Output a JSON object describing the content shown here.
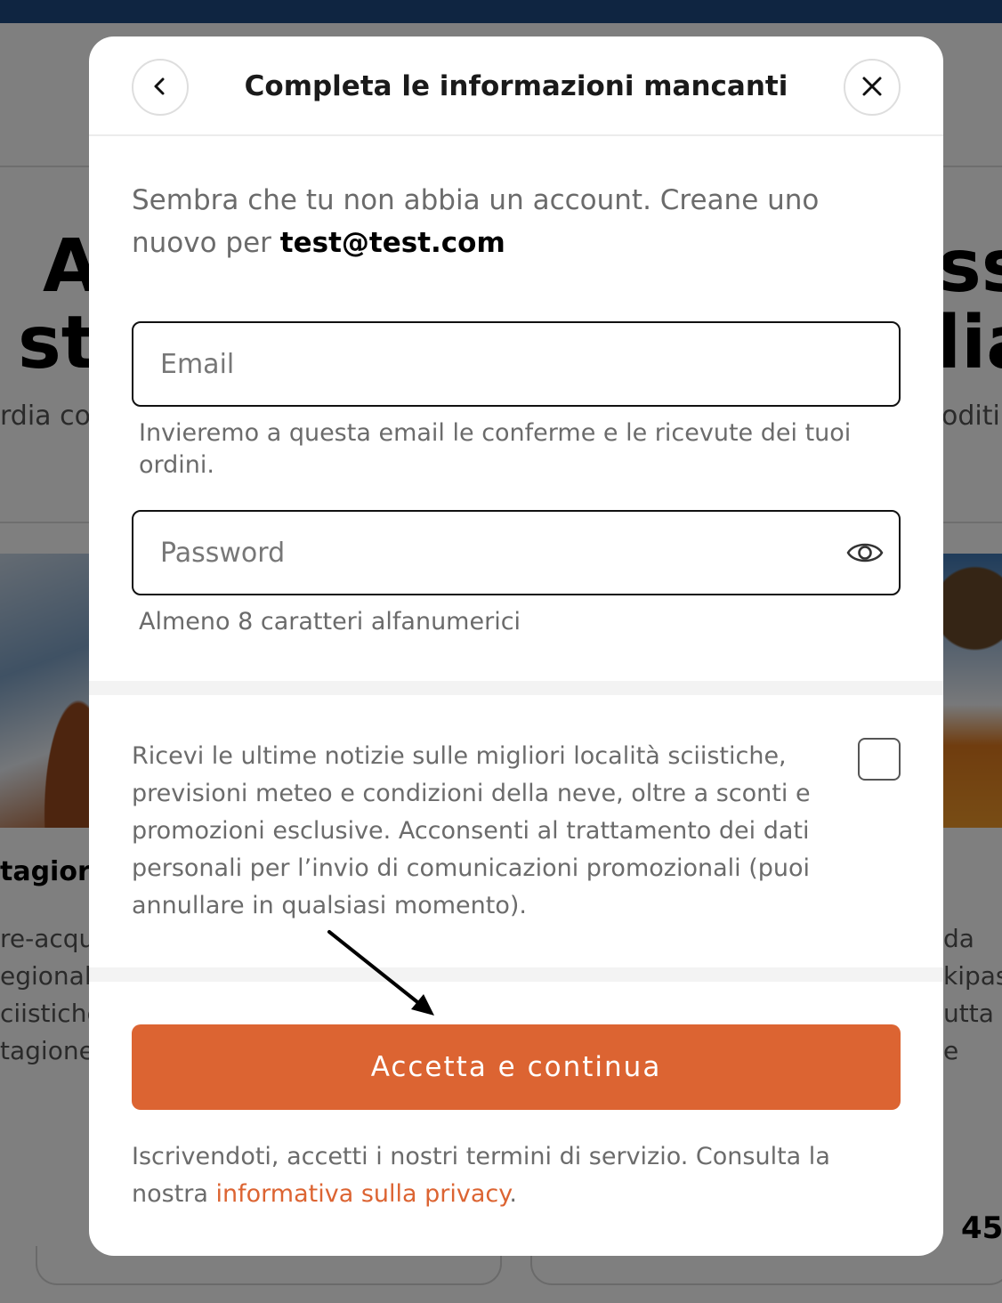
{
  "background": {
    "hero_left": [
      "A",
      "st"
    ],
    "hero_right": [
      "ss",
      "lia"
    ],
    "sub_left": "rdia co",
    "sub_right": "oditi",
    "card_title_left": "tagior",
    "card_left_lines": [
      "re-acqu",
      "egional",
      "ciistiche",
      "tagione"
    ],
    "card_right_lines": [
      "da",
      "kipas",
      "utta",
      "e"
    ],
    "number": "45"
  },
  "modal": {
    "title": "Completa le informazioni mancanti",
    "back_icon": "chevron-left-icon",
    "close_icon": "close-icon",
    "intro_text": "Sembra che tu non abbia un account. Creane uno nuovo per",
    "intro_email": "test@test.com",
    "email": {
      "placeholder": "Email",
      "value": "",
      "helper": "Invieremo a questa email le conferme e le ricevute dei tuoi ordini."
    },
    "password": {
      "placeholder": "Password",
      "value": "",
      "toggle_icon": "eye-icon",
      "helper": "Almeno 8 caratteri alfanumerici"
    },
    "consent": {
      "text": "Ricevi le ultime notizie sulle migliori località sciistiche, previsioni meteo e condizioni della neve, oltre a sconti e promozioni esclusive. Acconsenti al trattamento dei dati personali per l’invio di comunicazioni promozionali (puoi annullare in qualsiasi momento).",
      "checked": false
    },
    "submit_label": "Accetta e continua",
    "terms_text": "Iscrivendoti, accetti i nostri termini di servizio. Consulta la nostra",
    "privacy_link": "informativa sulla privacy",
    "terms_end": "."
  },
  "colors": {
    "accent": "#dc6432",
    "top_bar": "#1f4a82",
    "text_muted": "#6b6b6b"
  }
}
